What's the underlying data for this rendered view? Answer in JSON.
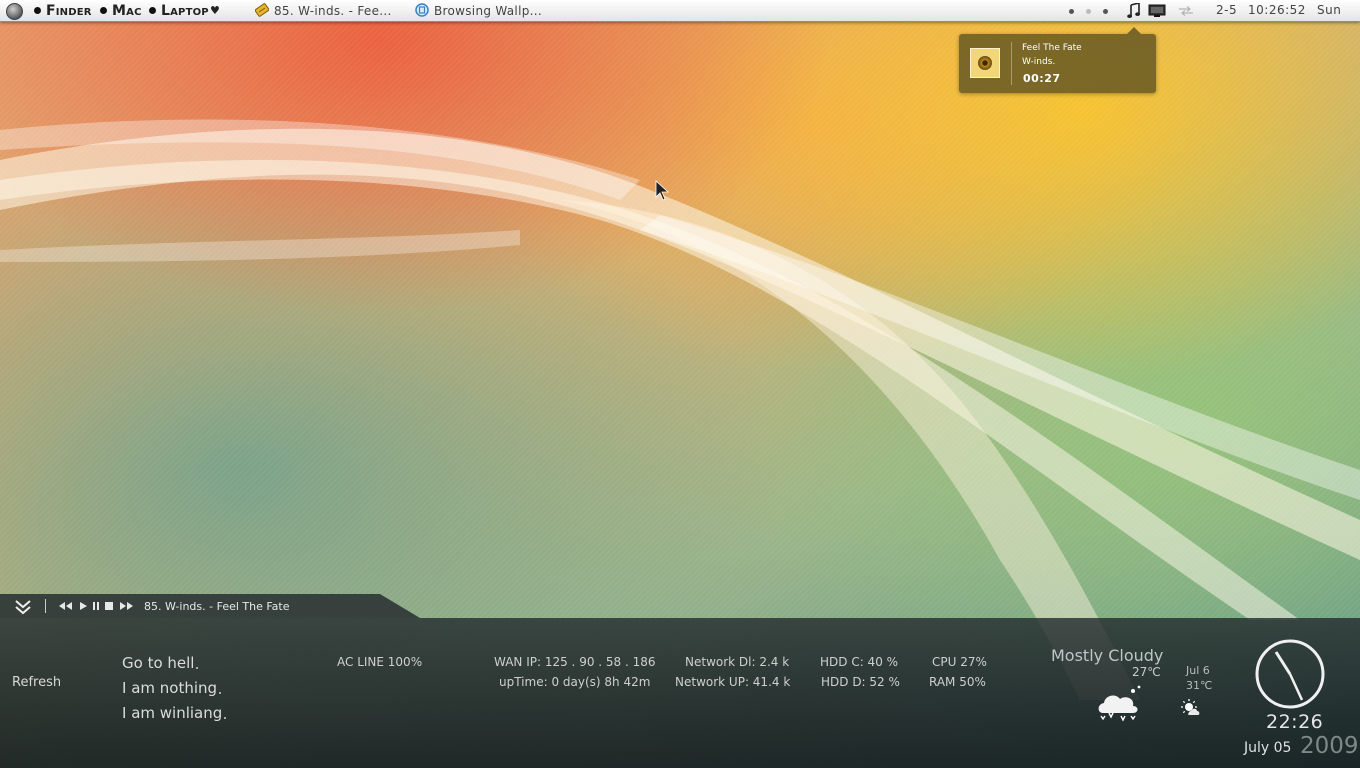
{
  "menubar": {
    "items": [
      {
        "label": "Finder"
      },
      {
        "label": "Mac"
      },
      {
        "label": "Laptop"
      }
    ],
    "heart_glyph": "♥",
    "tasks": [
      {
        "label": "85. W-inds. - Fee...",
        "icon": "music-player-icon"
      },
      {
        "label": "Browsing Wallp...",
        "icon": "browser-icon"
      }
    ],
    "status": {
      "workspace": "2-5",
      "time": "10:26:52",
      "day": "Sun"
    }
  },
  "popup": {
    "title": "Feel The Fate",
    "artist": "W-inds.",
    "elapsed": "00:27"
  },
  "media": {
    "now_playing": "85. W-inds. - Feel The Fate"
  },
  "panel": {
    "refresh": "Refresh",
    "quotes": [
      "Go to hell",
      "I am nothing",
      "I am winliang"
    ],
    "stats": {
      "ac_line": "AC LINE  100%",
      "wan_ip": "WAN IP: 125 . 90 . 58 . 186",
      "uptime": "upTime: 0 day(s) 8h 42m",
      "net_dl": "Network Dl: 2.4 k",
      "net_up": "Network UP: 41.4 k",
      "hdd_c": "HDD C: 40 %",
      "hdd_d": "HDD D: 52 %",
      "cpu": "CPU 27%",
      "ram": "RAM 50%"
    },
    "weather": {
      "condition": "Mostly Cloudy",
      "temp_now": "27℃",
      "forecast_date": "Jul 6",
      "forecast_temp": "31℃"
    },
    "clock": {
      "time": "22:26",
      "date": "July 05",
      "year": "2009"
    }
  }
}
